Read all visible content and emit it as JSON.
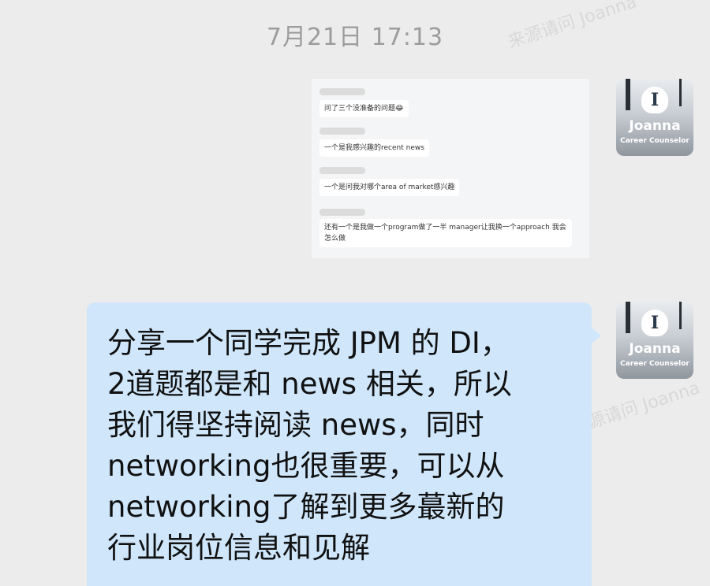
{
  "timestamp": "7月21日 17:13",
  "avatar": {
    "name": "Joanna",
    "role": "Career Counselor",
    "logo_glyph": "I"
  },
  "image_message": {
    "lines": [
      "问了三个没准备的问题😂",
      "一个是我感兴趣的recent news",
      "一个是问我对哪个area of market感兴趣",
      "还有一个是我做一个program做了一半 manager让我换一个approach 我会怎么做"
    ]
  },
  "text_message": "分享一个同学完成 JPM 的 DI，\n2道题都是和 news 相关，所以\n我们得坚持阅读 news，同时\nnetworking也很重要，可以从\nnetworking了解到更多蕞新的\n行业岗位信息和见解",
  "watermark": "来源请问 Joanna"
}
